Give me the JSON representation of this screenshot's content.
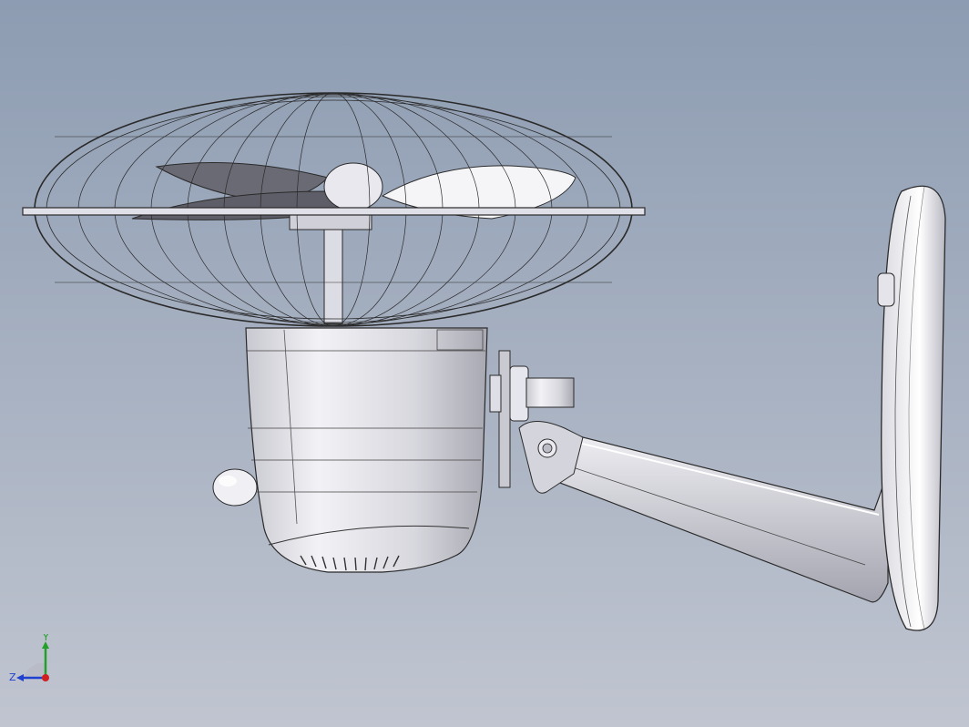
{
  "viewport": {
    "background_top": "#8d9cb2",
    "background_bottom": "#c0c5d0"
  },
  "model": {
    "parts": [
      "fan-guard",
      "fan-blades",
      "motor-housing",
      "knob",
      "swivel-bracket",
      "wall-arm",
      "wall-mount-plate"
    ]
  },
  "triad": {
    "y_label": "Y",
    "z_label": "Z",
    "y_color": "#22a02a",
    "z_color": "#2040d0",
    "x_color": "#d02020"
  }
}
